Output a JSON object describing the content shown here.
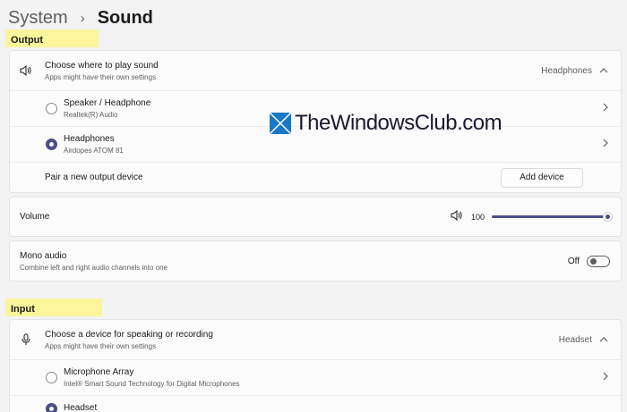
{
  "breadcrumb": {
    "parent": "System",
    "separator": "›",
    "current": "Sound"
  },
  "output": {
    "section_label": "Output",
    "choose": {
      "title": "Choose where to play sound",
      "subtitle": "Apps might have their own settings",
      "value": "Headphones"
    },
    "devices": [
      {
        "name": "Speaker / Headphone",
        "sub": "Realtek(R) Audio",
        "selected": false
      },
      {
        "name": "Headphones",
        "sub": "Airdopes ATOM 81",
        "selected": true
      }
    ],
    "pair": {
      "label": "Pair a new output device",
      "button": "Add device"
    }
  },
  "volume": {
    "label": "Volume",
    "value": "100",
    "level": 100
  },
  "mono": {
    "title": "Mono audio",
    "subtitle": "Combine left and right audio channels into one",
    "state": "Off"
  },
  "input": {
    "section_label": "Input",
    "choose": {
      "title": "Choose a device for speaking or recording",
      "subtitle": "Apps might have their own settings",
      "value": "Headset"
    },
    "devices": [
      {
        "name": "Microphone Array",
        "sub": "Intel® Smart Sound Technology for Digital Microphones",
        "selected": false
      },
      {
        "name": "Headset",
        "sub": "",
        "selected": true
      }
    ]
  },
  "watermark": {
    "text": "TheWindowsClub.com"
  },
  "colors": {
    "accent": "#4b4e8a",
    "highlight": "#fbf59c",
    "background": "#f3f3f3",
    "card": "#fbfbfb"
  },
  "icons": {
    "speaker": "speaker-icon",
    "microphone": "microphone-icon",
    "chevron_right": "chevron-right-icon",
    "chevron_up": "chevron-up-icon"
  }
}
